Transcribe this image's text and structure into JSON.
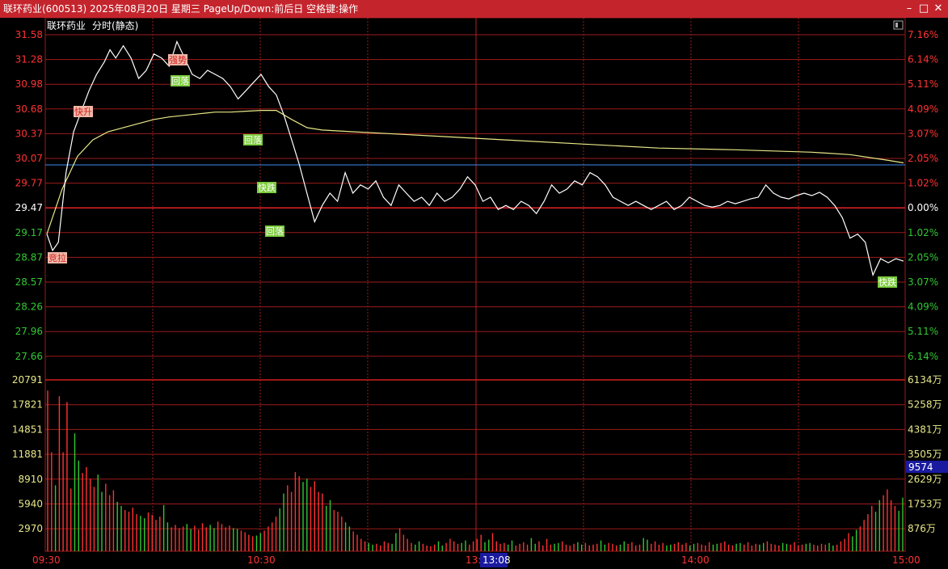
{
  "window": {
    "title": "联环药业(600513) 2025年08月20日 星期三 PageUp/Down:前后日 空格键:操作",
    "minimize_icon": "minimize-icon",
    "maximize_icon": "maximize-icon",
    "close_icon": "close-icon"
  },
  "header": {
    "stock_name": "联环药业",
    "mode_label": "分时(静态)",
    "toggle_icon": "panel-toggle-icon"
  },
  "colors": {
    "up": "#ff3232",
    "down": "#32c832",
    "price_line": "#ffffff",
    "avg_line": "#e8e888",
    "prev_close_line": "#3c8cf0",
    "grid": "#9b1b1b",
    "volume_label": "#e8e888",
    "crosshair_box": "#1a1aa0"
  },
  "price_axis": {
    "left": [
      "31.58",
      "31.28",
      "30.98",
      "30.68",
      "30.37",
      "30.07",
      "29.77",
      "29.47",
      "29.17",
      "28.87",
      "28.57",
      "28.26",
      "27.96",
      "27.66"
    ],
    "right": [
      "7.16%",
      "6.14%",
      "5.11%",
      "4.09%",
      "3.07%",
      "2.05%",
      "1.02%",
      "0.00%",
      "1.02%",
      "2.05%",
      "3.07%",
      "4.09%",
      "5.11%",
      "6.14%"
    ],
    "prev_close": "29.47"
  },
  "volume_axis": {
    "left": [
      "20791",
      "17821",
      "14851",
      "11881",
      "8910",
      "5940",
      "2970"
    ],
    "right": [
      "6134万",
      "5258万",
      "4381万",
      "3505万",
      "2629万",
      "1753万",
      "876万"
    ],
    "cursor_value": "9574"
  },
  "time_axis": {
    "labels": [
      "09:30",
      "10:30",
      "13:00",
      "14:00",
      "15:00"
    ],
    "cursor_label": "13:08"
  },
  "annotations": [
    {
      "text": "竞拉",
      "kind": "up"
    },
    {
      "text": "快升",
      "kind": "up"
    },
    {
      "text": "强势",
      "kind": "up"
    },
    {
      "text": "回落",
      "kind": "down"
    },
    {
      "text": "回落",
      "kind": "down"
    },
    {
      "text": "快跌",
      "kind": "down"
    },
    {
      "text": "回落",
      "kind": "down"
    },
    {
      "text": "快跌",
      "kind": "down"
    }
  ],
  "chart_data": {
    "type": "line",
    "price_series": [
      [
        0,
        29.15
      ],
      [
        3,
        28.95
      ],
      [
        6,
        29.05
      ],
      [
        10,
        29.9
      ],
      [
        14,
        30.4
      ],
      [
        18,
        30.65
      ],
      [
        22,
        30.9
      ],
      [
        26,
        31.1
      ],
      [
        30,
        31.25
      ],
      [
        33,
        31.4
      ],
      [
        36,
        31.3
      ],
      [
        40,
        31.45
      ],
      [
        44,
        31.3
      ],
      [
        48,
        31.05
      ],
      [
        52,
        31.15
      ],
      [
        56,
        31.35
      ],
      [
        60,
        31.3
      ],
      [
        64,
        31.2
      ],
      [
        68,
        31.5
      ],
      [
        72,
        31.3
      ],
      [
        76,
        31.1
      ],
      [
        80,
        31.05
      ],
      [
        84,
        31.15
      ],
      [
        88,
        31.1
      ],
      [
        92,
        31.05
      ],
      [
        96,
        30.95
      ],
      [
        100,
        30.8
      ],
      [
        104,
        30.9
      ],
      [
        108,
        31.0
      ],
      [
        112,
        31.1
      ],
      [
        116,
        30.95
      ],
      [
        120,
        30.85
      ],
      [
        124,
        30.6
      ],
      [
        128,
        30.3
      ],
      [
        132,
        30.0
      ],
      [
        136,
        29.65
      ],
      [
        140,
        29.3
      ],
      [
        144,
        29.5
      ],
      [
        148,
        29.65
      ],
      [
        152,
        29.55
      ],
      [
        156,
        29.9
      ],
      [
        160,
        29.65
      ],
      [
        164,
        29.75
      ],
      [
        168,
        29.7
      ],
      [
        172,
        29.8
      ],
      [
        176,
        29.6
      ],
      [
        180,
        29.5
      ],
      [
        184,
        29.75
      ],
      [
        188,
        29.65
      ],
      [
        192,
        29.55
      ],
      [
        196,
        29.6
      ],
      [
        200,
        29.5
      ],
      [
        204,
        29.65
      ],
      [
        208,
        29.55
      ],
      [
        212,
        29.6
      ],
      [
        216,
        29.7
      ],
      [
        220,
        29.85
      ],
      [
        224,
        29.75
      ],
      [
        228,
        29.55
      ],
      [
        232,
        29.6
      ],
      [
        236,
        29.45
      ],
      [
        240,
        29.5
      ],
      [
        244,
        29.45
      ],
      [
        248,
        29.55
      ],
      [
        252,
        29.5
      ],
      [
        256,
        29.4
      ],
      [
        260,
        29.55
      ],
      [
        264,
        29.75
      ],
      [
        268,
        29.65
      ],
      [
        272,
        29.7
      ],
      [
        276,
        29.8
      ],
      [
        280,
        29.75
      ],
      [
        284,
        29.9
      ],
      [
        288,
        29.85
      ],
      [
        292,
        29.75
      ],
      [
        296,
        29.6
      ],
      [
        300,
        29.55
      ],
      [
        304,
        29.5
      ],
      [
        308,
        29.55
      ],
      [
        312,
        29.5
      ],
      [
        316,
        29.45
      ],
      [
        320,
        29.5
      ],
      [
        324,
        29.55
      ],
      [
        328,
        29.45
      ],
      [
        332,
        29.5
      ],
      [
        336,
        29.6
      ],
      [
        340,
        29.55
      ],
      [
        344,
        29.5
      ],
      [
        348,
        29.48
      ],
      [
        352,
        29.5
      ],
      [
        356,
        29.55
      ],
      [
        360,
        29.52
      ],
      [
        364,
        29.55
      ],
      [
        368,
        29.58
      ],
      [
        372,
        29.6
      ],
      [
        376,
        29.75
      ],
      [
        380,
        29.65
      ],
      [
        384,
        29.6
      ],
      [
        388,
        29.58
      ],
      [
        392,
        29.62
      ],
      [
        396,
        29.65
      ],
      [
        400,
        29.62
      ],
      [
        404,
        29.66
      ],
      [
        408,
        29.6
      ],
      [
        412,
        29.5
      ],
      [
        416,
        29.35
      ],
      [
        420,
        29.1
      ],
      [
        424,
        29.15
      ],
      [
        428,
        29.05
      ],
      [
        432,
        28.65
      ],
      [
        436,
        28.85
      ],
      [
        440,
        28.8
      ],
      [
        444,
        28.85
      ],
      [
        448,
        28.82
      ]
    ],
    "avg_series": [
      [
        0,
        29.15
      ],
      [
        8,
        29.7
      ],
      [
        16,
        30.1
      ],
      [
        24,
        30.3
      ],
      [
        32,
        30.4
      ],
      [
        40,
        30.45
      ],
      [
        48,
        30.5
      ],
      [
        56,
        30.55
      ],
      [
        64,
        30.58
      ],
      [
        72,
        30.6
      ],
      [
        80,
        30.62
      ],
      [
        88,
        30.64
      ],
      [
        96,
        30.64
      ],
      [
        104,
        30.65
      ],
      [
        112,
        30.66
      ],
      [
        120,
        30.66
      ],
      [
        128,
        30.55
      ],
      [
        136,
        30.45
      ],
      [
        144,
        30.42
      ],
      [
        160,
        30.4
      ],
      [
        200,
        30.35
      ],
      [
        240,
        30.3
      ],
      [
        280,
        30.25
      ],
      [
        320,
        30.2
      ],
      [
        360,
        30.18
      ],
      [
        400,
        30.15
      ],
      [
        420,
        30.12
      ],
      [
        440,
        30.05
      ],
      [
        448,
        30.02
      ]
    ],
    "volume_series": [
      19500,
      12000,
      8000,
      18800,
      12000,
      18100,
      7600,
      14300,
      11000,
      9500,
      10200,
      8800,
      7800,
      9300,
      7200,
      8200,
      6800,
      7400,
      6000,
      5500,
      5000,
      4800,
      5300,
      4500,
      4300,
      4000,
      4700,
      4400,
      3800,
      4200,
      5600,
      3500,
      2900,
      3200,
      2800,
      3000,
      3300,
      2700,
      3100,
      2600,
      3400,
      2900,
      3200,
      2800,
      3600,
      3300,
      2900,
      3100,
      2800,
      2700,
      2500,
      2300,
      2000,
      1800,
      1900,
      2200,
      2500,
      3000,
      3500,
      4200,
      5200,
      7000,
      8000,
      7200,
      9600,
      9100,
      8400,
      8800,
      7800,
      8500,
      7200,
      7000,
      5500,
      6200,
      5000,
      4800,
      4200,
      3500,
      3000,
      2400,
      2000,
      1500,
      1200,
      1000,
      800,
      900,
      700,
      1200,
      1000,
      900,
      2200,
      2800,
      2000,
      1500,
      1000,
      800,
      1200,
      900,
      700,
      600,
      800,
      1200,
      700,
      1000,
      1500,
      1200,
      900,
      1000,
      1300,
      800,
      1200,
      1500,
      2000,
      1100,
      1400,
      2200,
      1200,
      900,
      1000,
      800,
      1300,
      700,
      900,
      1100,
      800,
      1600,
      900,
      1200,
      700,
      1500,
      800,
      900,
      1000,
      1200,
      800,
      700,
      900,
      1100,
      800,
      1000,
      700,
      800,
      900,
      1300,
      800,
      1000,
      900,
      700,
      800,
      1200,
      900,
      1100,
      700,
      800,
      1600,
      1400,
      900,
      1200,
      800,
      1000,
      700,
      800,
      900,
      1100,
      800,
      1000,
      700,
      900,
      1000,
      800,
      700,
      1100,
      800,
      900,
      1000,
      1200,
      800,
      700,
      900,
      1000,
      800,
      1100,
      700,
      900,
      800,
      1000,
      1200,
      900,
      800,
      700,
      1000,
      900,
      800,
      1100,
      700,
      800,
      900,
      1000,
      800,
      700,
      900,
      800,
      1000,
      700,
      800,
      1200,
      1500,
      2200,
      1800,
      2600,
      3000,
      3800,
      4500,
      5500,
      4800,
      6200,
      6800,
      7500,
      6200,
      5500,
      4900,
      6500
    ]
  }
}
